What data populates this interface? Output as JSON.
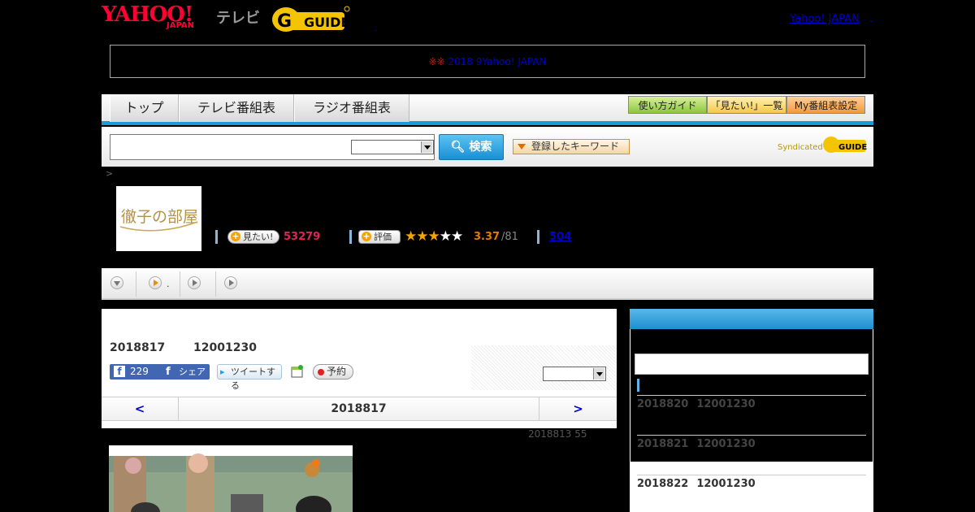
{
  "header": {
    "yahoo_logo": "YAHOO!",
    "japan_logo": "JAPAN",
    "tv_logo": "テレビ",
    "gguide_logo": "G GUIDE",
    "dot": ".",
    "yahoo_japan_link": "Yahoo! JAPAN",
    "dot2": "."
  },
  "notice": {
    "mark": "※※",
    "text": "2018 9 Yahoo! JAPAN",
    "link": "2018 9Yahoo! JAPAN　　　　　"
  },
  "nav": {
    "tabs": [
      "トップ",
      "テレビ番組表",
      "ラジオ番組表"
    ],
    "right_buttons": [
      "使い方ガイド",
      "「見たい!」一覧",
      "My番組表設定"
    ]
  },
  "search": {
    "input_value": "",
    "select_value": "",
    "button_label": "検索",
    "keyword_label": "登録したキーワード",
    "syndicated": "Syndicated",
    "syndicated_logo": "GUIDE"
  },
  "program": {
    "crumb": ">",
    "thumb_title": "徹子の部屋",
    "want_label": "見たい!",
    "want_count": "53279",
    "rate_label": "評価",
    "stars": "★★★★★",
    "rating_score": "3.37",
    "rating_count": "/81",
    "review_count": "504"
  },
  "tabs": {
    "second_label": "."
  },
  "episode": {
    "date": "2018817",
    "time": "12001230",
    "fb_like_count": "229",
    "fb_share_label": "シェア",
    "tweet_label": "ツイートする",
    "reserve_label": "予約",
    "day_prev": "<",
    "day_title": "2018817",
    "day_next": ">",
    "update_note": "2018813  55"
  },
  "sidebar": {
    "items": [
      {
        "date": "2018820",
        "time": "12001230"
      },
      {
        "date": "2018821",
        "time": "12001230"
      },
      {
        "date": "2018822",
        "time": "12001230"
      }
    ]
  },
  "colors": {
    "accent_blue": "#1e9ad8",
    "yahoo_red": "#ff0033",
    "want_pink": "#e0245a",
    "rating_orange": "#e37b00",
    "fb_blue": "#4267b2"
  }
}
